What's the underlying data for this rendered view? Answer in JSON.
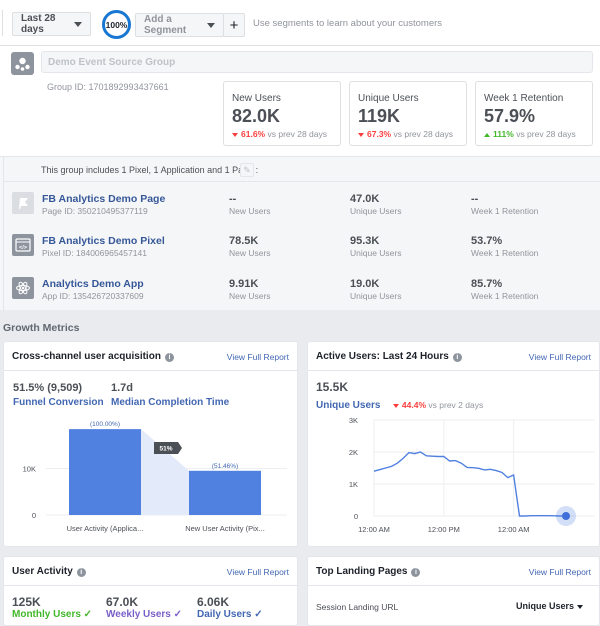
{
  "toolbar": {
    "date_range": "Last 28 days",
    "sample_pct": "100%",
    "segment_label": "Add a Segment",
    "add_label": "+",
    "hint": "Use segments to learn about your customers"
  },
  "group": {
    "name": "Demo Event Source Group",
    "id_text": "Group ID: 1701892993437661",
    "kpis": [
      {
        "label": "New Users",
        "value": "82.0K",
        "change": "61.6%",
        "direction": "down",
        "suffix": "vs prev 28 days"
      },
      {
        "label": "Unique Users",
        "value": "119K",
        "change": "67.3%",
        "direction": "down",
        "suffix": "vs prev 28 days"
      },
      {
        "label": "Week 1 Retention",
        "value": "57.9%",
        "change": "111%",
        "direction": "up",
        "suffix": "vs prev 28 days"
      }
    ]
  },
  "sources": {
    "includes_text": "This group includes 1 Pixel, 1 Application and 1 Page :",
    "items": [
      {
        "icon": "flag-icon",
        "name": "FB Analytics Demo Page",
        "id_text": "Page ID: 350210495377119",
        "new_users": "--",
        "new_users_label": "New Users",
        "unique_users": "47.0K",
        "unique_users_label": "Unique Users",
        "retention": "--",
        "retention_label": "Week 1 Retention"
      },
      {
        "icon": "code-icon",
        "name": "FB Analytics Demo Pixel",
        "id_text": "Pixel ID: 184006965457141",
        "new_users": "78.5K",
        "new_users_label": "New Users",
        "unique_users": "95.3K",
        "unique_users_label": "Unique Users",
        "retention": "53.7%",
        "retention_label": "Week 1 Retention"
      },
      {
        "icon": "atom-icon",
        "name": "Analytics Demo App",
        "id_text": "App ID: 135426720337609",
        "new_users": "9.91K",
        "new_users_label": "New Users",
        "unique_users": "19.0K",
        "unique_users_label": "Unique Users",
        "retention": "85.7%",
        "retention_label": "Week 1 Retention"
      }
    ]
  },
  "growth": {
    "title": "Growth Metrics",
    "view_full_report": "View Full Report",
    "acquisition": {
      "title": "Cross-channel user acquisition",
      "funnel_value": "51.5% (9,509)",
      "funnel_label": "Funnel Conversion",
      "median_value": "1.7d",
      "median_label": "Median Completion Time"
    },
    "active": {
      "title": "Active Users: Last 24 Hours",
      "value": "15.5K",
      "label": "Unique Users",
      "change": "44.4%",
      "direction": "down",
      "suffix": "vs prev 2 days"
    },
    "user_activity": {
      "title": "User Activity",
      "stats": [
        {
          "value": "125K",
          "label": "Monthly Users",
          "color": "#42b72a"
        },
        {
          "value": "67.0K",
          "label": "Weekly Users",
          "color": "#7b5fc9"
        },
        {
          "value": "6.06K",
          "label": "Daily Users",
          "color": "#4267b2"
        }
      ]
    },
    "landing": {
      "title": "Top Landing Pages",
      "col1": "Session Landing URL",
      "col2": "Unique Users"
    }
  },
  "chart_data": [
    {
      "type": "bar",
      "title": "Cross-channel user acquisition",
      "categories": [
        "User Activity (Applica...",
        "New User Activity (Pix..."
      ],
      "values": [
        18470,
        9509
      ],
      "data_labels": [
        "(100.00%)",
        "(51.46%)"
      ],
      "step_label": "51%",
      "yticks": [
        "0",
        "10K"
      ],
      "ylim": [
        0,
        20000
      ],
      "grid": true,
      "color": "#5081e0"
    },
    {
      "type": "line",
      "title": "Active Users: Last 24 Hours",
      "xticks": [
        "12:00 AM",
        "12:00 PM",
        "12:00 AM"
      ],
      "yticks": [
        "0",
        "1K",
        "2K",
        "3K"
      ],
      "ylim": [
        0,
        3000
      ],
      "x_hours": [
        0,
        2,
        3,
        4,
        5,
        6,
        7,
        8,
        9,
        10,
        11,
        12,
        13,
        14,
        15,
        16,
        17,
        18,
        19,
        20,
        21,
        22,
        23,
        24,
        25,
        26,
        27,
        28,
        29,
        30,
        31,
        32,
        33
      ],
      "values": [
        1400,
        1500,
        1550,
        1650,
        1800,
        1980,
        1950,
        2000,
        1880,
        1870,
        1860,
        1860,
        1720,
        1730,
        1650,
        1520,
        1510,
        1490,
        1440,
        1460,
        1420,
        1360,
        1200,
        1280,
        0,
        0,
        10,
        10,
        10,
        10,
        5,
        0,
        0
      ],
      "color": "#5081e0",
      "grid": true
    }
  ]
}
